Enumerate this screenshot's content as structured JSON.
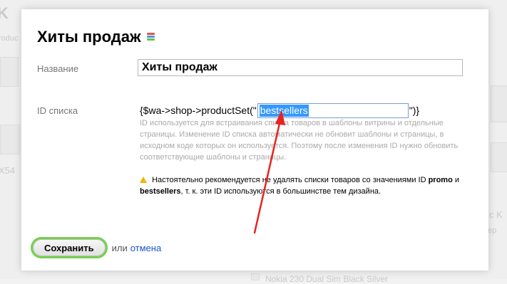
{
  "background": {
    "heading_fragment": "K",
    "product_fragment": "roduc",
    "model_fragment_left": "X54",
    "model_fragment_right": "c K",
    "small_fragment_right": "ер",
    "bottom_fragment": "Nokia 230 Dual Sim Black Silver"
  },
  "dialog": {
    "title": "Хиты продаж",
    "name_label": "Название",
    "name_value": "Хиты продаж",
    "id_label": "ID списка",
    "code_prefix": "{$wa->shop->productSet(\"",
    "id_value": "bestsellers",
    "code_suffix": "\")}",
    "hint_text": "ID используется для встраивания списка товаров в шаблоны витрины и отдельные страницы. Изменение ID списка автоматически не обновит шаблоны и страницы, в исходном коде которых он используется. Поэтому после изменения ID нужно обновить соответствующие шаблоны и страницы.",
    "warning": {
      "text_1": "Настоятельно рекомендуется не удалять списки товаров со значениями ID",
      "id_1": "promo",
      "and": "и",
      "id_2": "bestsellers",
      "text_2": ", т. к. эти ID используются в большинстве тем дизайна."
    },
    "save_label": "Сохранить",
    "or_label": "или",
    "cancel_label": "отмена"
  },
  "colors": {
    "save_button_border": "#74d14b",
    "link": "#1a55c8",
    "selection": "#3399ff",
    "annotation_arrow": "#e8231f",
    "warning_icon": "#f0b400"
  },
  "icons": {
    "title_icon": "colored-bars-icon",
    "warning_icon": "warning-icon",
    "annotation": "red-arrow"
  }
}
